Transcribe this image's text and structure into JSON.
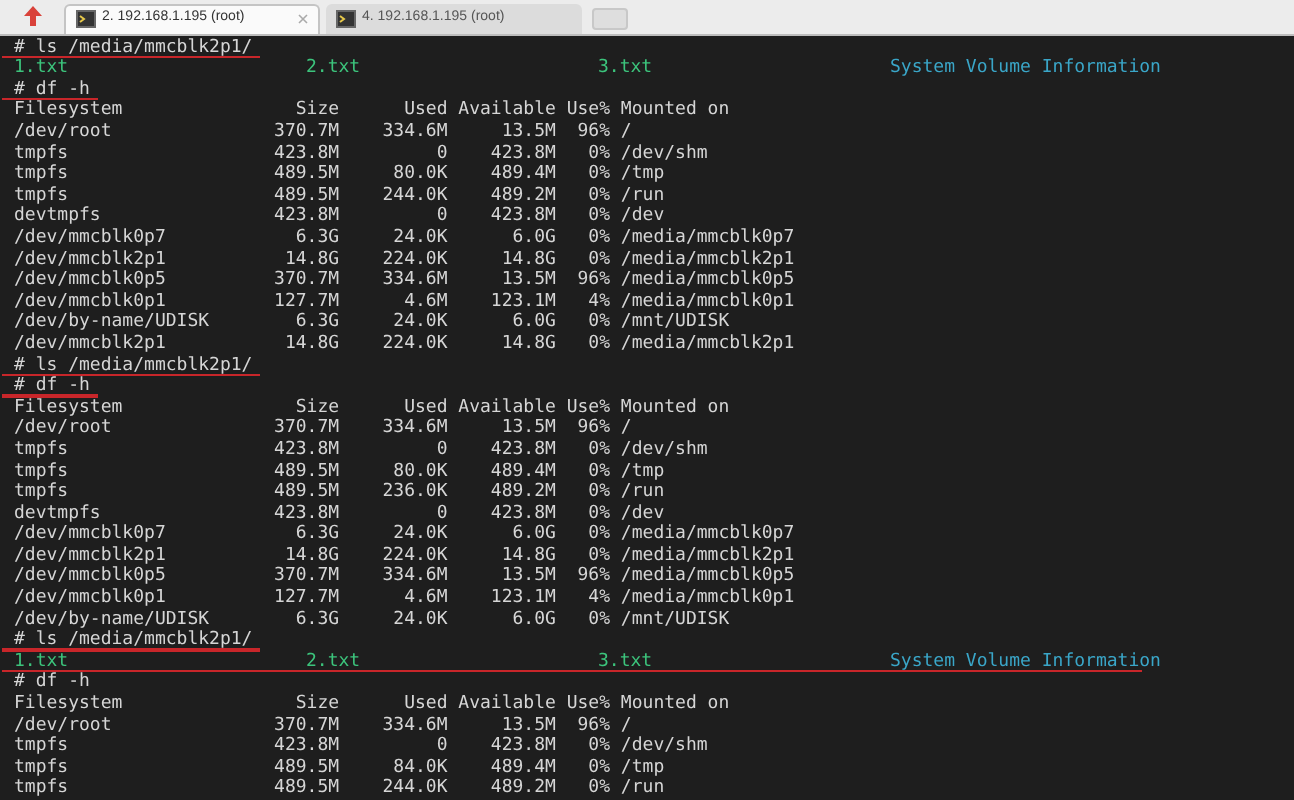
{
  "tabs": [
    {
      "label": "2. 192.168.1.195 (root)",
      "selected": true
    },
    {
      "label": "4. 192.168.1.195 (root)",
      "selected": false
    }
  ],
  "terminal": {
    "lines": [
      {
        "kind": "command",
        "text": "# ls /media/mmcblk2p1/",
        "underlined": true
      },
      {
        "kind": "files",
        "underlined": false,
        "items": [
          {
            "name": "1.txt",
            "color": "#3cc47c"
          },
          {
            "name": "2.txt",
            "color": "#3cc47c"
          },
          {
            "name": "3.txt",
            "color": "#3cc47c"
          },
          {
            "name": "System Volume Information",
            "color": "#3aa6c8"
          }
        ]
      },
      {
        "kind": "command",
        "text": "# df -h",
        "underlined": true
      },
      {
        "kind": "row",
        "underlined": false,
        "cells": [
          "Filesystem",
          "Size",
          "Used",
          "Available",
          "Use%",
          "Mounted on"
        ]
      },
      {
        "kind": "row",
        "underlined": false,
        "cells": [
          "/dev/root",
          "370.7M",
          "334.6M",
          "13.5M",
          "96%",
          "/"
        ]
      },
      {
        "kind": "row",
        "underlined": false,
        "cells": [
          "tmpfs",
          "423.8M",
          "0",
          "423.8M",
          "0%",
          "/dev/shm"
        ]
      },
      {
        "kind": "row",
        "underlined": false,
        "cells": [
          "tmpfs",
          "489.5M",
          "80.0K",
          "489.4M",
          "0%",
          "/tmp"
        ]
      },
      {
        "kind": "row",
        "underlined": false,
        "cells": [
          "tmpfs",
          "489.5M",
          "244.0K",
          "489.2M",
          "0%",
          "/run"
        ]
      },
      {
        "kind": "row",
        "underlined": false,
        "cells": [
          "devtmpfs",
          "423.8M",
          "0",
          "423.8M",
          "0%",
          "/dev"
        ]
      },
      {
        "kind": "row",
        "underlined": false,
        "cells": [
          "/dev/mmcblk0p7",
          "6.3G",
          "24.0K",
          "6.0G",
          "0%",
          "/media/mmcblk0p7"
        ]
      },
      {
        "kind": "row",
        "underlined": false,
        "cells": [
          "/dev/mmcblk2p1",
          "14.8G",
          "224.0K",
          "14.8G",
          "0%",
          "/media/mmcblk2p1"
        ]
      },
      {
        "kind": "row",
        "underlined": false,
        "cells": [
          "/dev/mmcblk0p5",
          "370.7M",
          "334.6M",
          "13.5M",
          "96%",
          "/media/mmcblk0p5"
        ]
      },
      {
        "kind": "row",
        "underlined": false,
        "cells": [
          "/dev/mmcblk0p1",
          "127.7M",
          "4.6M",
          "123.1M",
          "4%",
          "/media/mmcblk0p1"
        ]
      },
      {
        "kind": "row",
        "underlined": false,
        "cells": [
          "/dev/by-name/UDISK",
          "6.3G",
          "24.0K",
          "6.0G",
          "0%",
          "/mnt/UDISK"
        ]
      },
      {
        "kind": "row",
        "underlined": false,
        "cells": [
          "/dev/mmcblk2p1",
          "14.8G",
          "224.0K",
          "14.8G",
          "0%",
          "/media/mmcblk2p1"
        ]
      },
      {
        "kind": "command",
        "text": "# ls /media/mmcblk2p1/",
        "underlined": true
      },
      {
        "kind": "command",
        "text": "# df -h",
        "underlined": true
      },
      {
        "kind": "row",
        "underlined": false,
        "cells": [
          "Filesystem",
          "Size",
          "Used",
          "Available",
          "Use%",
          "Mounted on"
        ]
      },
      {
        "kind": "row",
        "underlined": false,
        "cells": [
          "/dev/root",
          "370.7M",
          "334.6M",
          "13.5M",
          "96%",
          "/"
        ]
      },
      {
        "kind": "row",
        "underlined": false,
        "cells": [
          "tmpfs",
          "423.8M",
          "0",
          "423.8M",
          "0%",
          "/dev/shm"
        ]
      },
      {
        "kind": "row",
        "underlined": false,
        "cells": [
          "tmpfs",
          "489.5M",
          "80.0K",
          "489.4M",
          "0%",
          "/tmp"
        ]
      },
      {
        "kind": "row",
        "underlined": false,
        "cells": [
          "tmpfs",
          "489.5M",
          "236.0K",
          "489.2M",
          "0%",
          "/run"
        ]
      },
      {
        "kind": "row",
        "underlined": false,
        "cells": [
          "devtmpfs",
          "423.8M",
          "0",
          "423.8M",
          "0%",
          "/dev"
        ]
      },
      {
        "kind": "row",
        "underlined": false,
        "cells": [
          "/dev/mmcblk0p7",
          "6.3G",
          "24.0K",
          "6.0G",
          "0%",
          "/media/mmcblk0p7"
        ]
      },
      {
        "kind": "row",
        "underlined": false,
        "cells": [
          "/dev/mmcblk2p1",
          "14.8G",
          "224.0K",
          "14.8G",
          "0%",
          "/media/mmcblk2p1"
        ]
      },
      {
        "kind": "row",
        "underlined": false,
        "cells": [
          "/dev/mmcblk0p5",
          "370.7M",
          "334.6M",
          "13.5M",
          "96%",
          "/media/mmcblk0p5"
        ]
      },
      {
        "kind": "row",
        "underlined": false,
        "cells": [
          "/dev/mmcblk0p1",
          "127.7M",
          "4.6M",
          "123.1M",
          "4%",
          "/media/mmcblk0p1"
        ]
      },
      {
        "kind": "row",
        "underlined": false,
        "cells": [
          "/dev/by-name/UDISK",
          "6.3G",
          "24.0K",
          "6.0G",
          "0%",
          "/mnt/UDISK"
        ]
      },
      {
        "kind": "command",
        "text": "# ls /media/mmcblk2p1/",
        "underlined": true
      },
      {
        "kind": "files",
        "underlined": true,
        "items": [
          {
            "name": "1.txt",
            "color": "#3cc47c"
          },
          {
            "name": "2.txt",
            "color": "#3cc47c"
          },
          {
            "name": "3.txt",
            "color": "#3cc47c"
          },
          {
            "name": "System Volume Information",
            "color": "#3aa6c8"
          }
        ]
      },
      {
        "kind": "command",
        "text": "# df -h",
        "underlined": false
      },
      {
        "kind": "row",
        "underlined": false,
        "cells": [
          "Filesystem",
          "Size",
          "Used",
          "Available",
          "Use%",
          "Mounted on"
        ]
      },
      {
        "kind": "row",
        "underlined": false,
        "cells": [
          "/dev/root",
          "370.7M",
          "334.6M",
          "13.5M",
          "96%",
          "/"
        ]
      },
      {
        "kind": "row",
        "underlined": false,
        "cells": [
          "tmpfs",
          "423.8M",
          "0",
          "423.8M",
          "0%",
          "/dev/shm"
        ]
      },
      {
        "kind": "row",
        "underlined": false,
        "cells": [
          "tmpfs",
          "489.5M",
          "84.0K",
          "489.4M",
          "0%",
          "/tmp"
        ]
      },
      {
        "kind": "row",
        "underlined": false,
        "cells": [
          "tmpfs",
          "489.5M",
          "244.0K",
          "489.2M",
          "0%",
          "/run"
        ]
      }
    ]
  }
}
